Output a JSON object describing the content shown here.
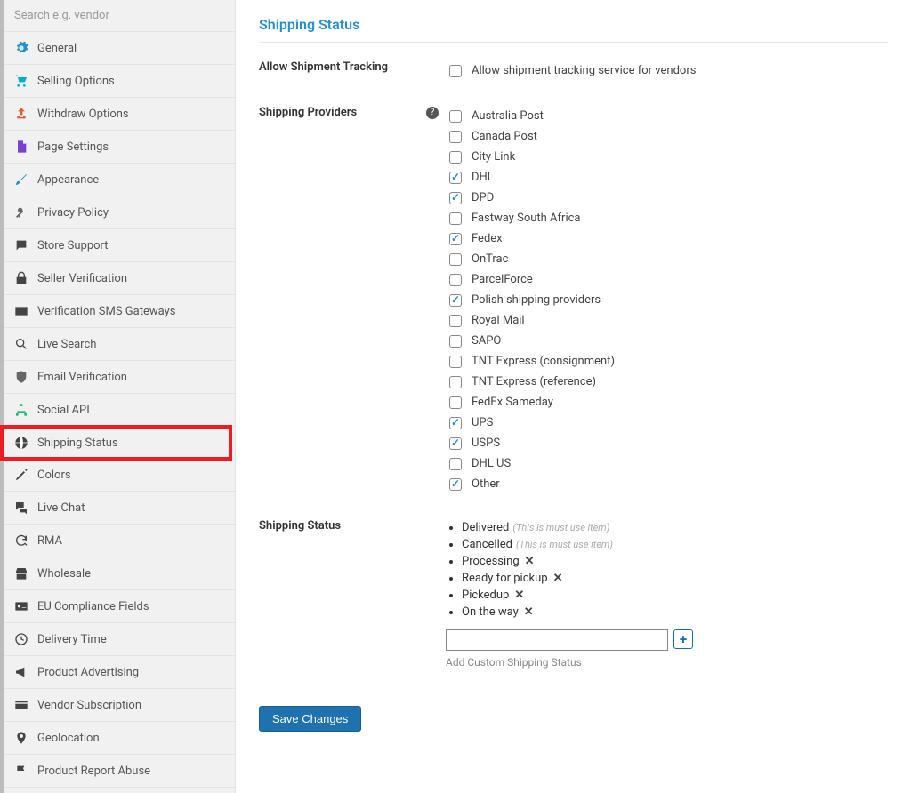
{
  "sidebar": {
    "search_placeholder": "Search e.g. vendor",
    "items": [
      {
        "label": "General",
        "icon": "gear",
        "color": "#1f8fd6"
      },
      {
        "label": "Selling Options",
        "icon": "cart",
        "color": "#00b3cc"
      },
      {
        "label": "Withdraw Options",
        "icon": "upload",
        "color": "#e65a2d"
      },
      {
        "label": "Page Settings",
        "icon": "page",
        "color": "#7b3fd4"
      },
      {
        "label": "Appearance",
        "icon": "brush",
        "color": "#1f8fd6"
      },
      {
        "label": "Privacy Policy",
        "icon": "key",
        "color": "#666"
      },
      {
        "label": "Store Support",
        "icon": "chat",
        "color": "#444"
      },
      {
        "label": "Seller Verification",
        "icon": "lock",
        "color": "#444"
      },
      {
        "label": "Verification SMS Gateways",
        "icon": "mail",
        "color": "#444"
      },
      {
        "label": "Live Search",
        "icon": "search",
        "color": "#444"
      },
      {
        "label": "Email Verification",
        "icon": "shield",
        "color": "#666"
      },
      {
        "label": "Social API",
        "icon": "sitemap",
        "color": "#1fb67a"
      },
      {
        "label": "Shipping Status",
        "icon": "globe",
        "color": "#444",
        "highlight": true
      },
      {
        "label": "Colors",
        "icon": "pencil",
        "color": "#444"
      },
      {
        "label": "Live Chat",
        "icon": "chats",
        "color": "#444"
      },
      {
        "label": "RMA",
        "icon": "refresh",
        "color": "#444"
      },
      {
        "label": "Wholesale",
        "icon": "store",
        "color": "#444"
      },
      {
        "label": "EU Compliance Fields",
        "icon": "id",
        "color": "#444"
      },
      {
        "label": "Delivery Time",
        "icon": "clock",
        "color": "#444"
      },
      {
        "label": "Product Advertising",
        "icon": "megaphone",
        "color": "#444"
      },
      {
        "label": "Vendor Subscription",
        "icon": "card",
        "color": "#444"
      },
      {
        "label": "Geolocation",
        "icon": "marker",
        "color": "#444"
      },
      {
        "label": "Product Report Abuse",
        "icon": "flag",
        "color": "#444"
      }
    ]
  },
  "page": {
    "title": "Shipping Status",
    "tracking": {
      "label": "Allow Shipment Tracking",
      "option_label": "Allow shipment tracking service for vendors",
      "checked": false
    },
    "providers": {
      "label": "Shipping Providers",
      "items": [
        {
          "label": "Australia Post",
          "checked": false
        },
        {
          "label": "Canada Post",
          "checked": false
        },
        {
          "label": "City Link",
          "checked": false
        },
        {
          "label": "DHL",
          "checked": true
        },
        {
          "label": "DPD",
          "checked": true
        },
        {
          "label": "Fastway South Africa",
          "checked": false
        },
        {
          "label": "Fedex",
          "checked": true
        },
        {
          "label": "OnTrac",
          "checked": false
        },
        {
          "label": "ParcelForce",
          "checked": false
        },
        {
          "label": "Polish shipping providers",
          "checked": true
        },
        {
          "label": "Royal Mail",
          "checked": false
        },
        {
          "label": "SAPO",
          "checked": false
        },
        {
          "label": "TNT Express (consignment)",
          "checked": false
        },
        {
          "label": "TNT Express (reference)",
          "checked": false
        },
        {
          "label": "FedEx Sameday",
          "checked": false
        },
        {
          "label": "UPS",
          "checked": true
        },
        {
          "label": "USPS",
          "checked": true
        },
        {
          "label": "DHL US",
          "checked": false
        },
        {
          "label": "Other",
          "checked": true
        }
      ]
    },
    "statuses": {
      "label": "Shipping Status",
      "must_use_note": "(This is must use item)",
      "items": [
        {
          "label": "Delivered",
          "must_use": true
        },
        {
          "label": "Cancelled",
          "must_use": true
        },
        {
          "label": "Processing",
          "must_use": false
        },
        {
          "label": "Ready for pickup",
          "must_use": false
        },
        {
          "label": "Pickedup",
          "must_use": false
        },
        {
          "label": "On the way",
          "must_use": false
        }
      ],
      "add_helper": "Add Custom Shipping Status",
      "remove_glyph": "✕",
      "plus_glyph": "+"
    },
    "save_label": "Save Changes"
  }
}
